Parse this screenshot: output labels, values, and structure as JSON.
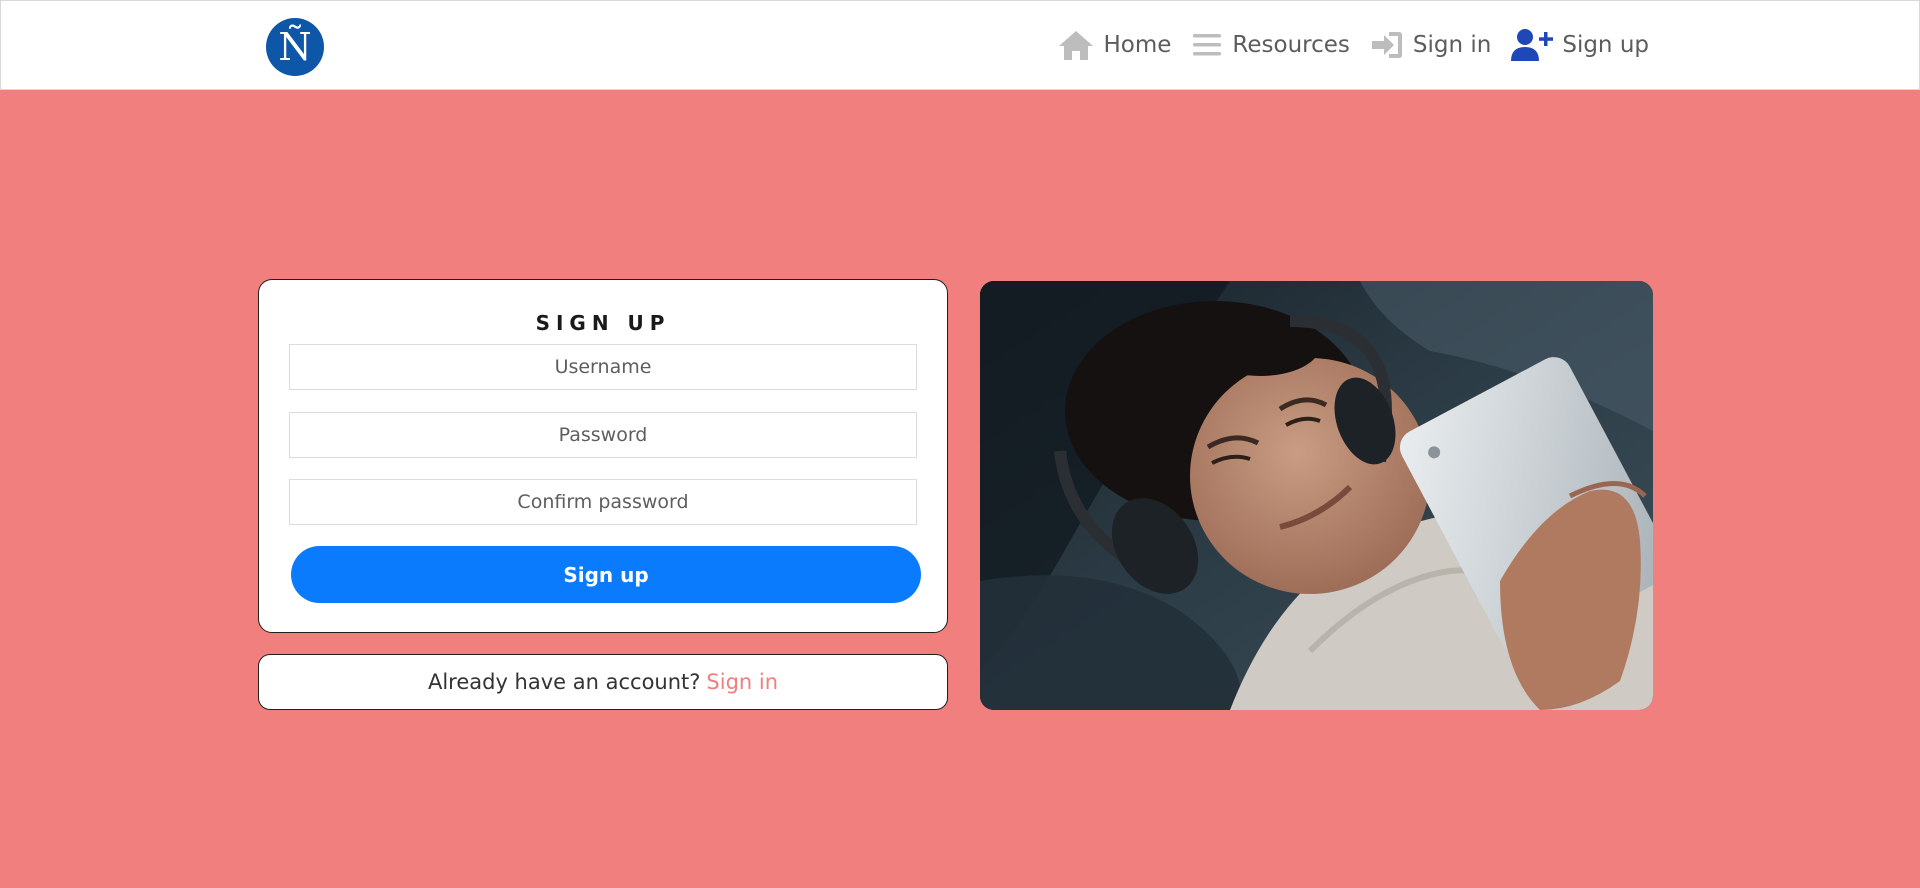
{
  "logo": {
    "glyph": "Ñ"
  },
  "nav": {
    "items": [
      {
        "label": "Home",
        "icon": "home-icon"
      },
      {
        "label": "Resources",
        "icon": "menu-icon"
      },
      {
        "label": "Sign in",
        "icon": "sign-in-icon"
      },
      {
        "label": "Sign up",
        "icon": "user-plus-icon"
      }
    ]
  },
  "form": {
    "title": "SIGN UP",
    "username_placeholder": "Username",
    "password_placeholder": "Password",
    "confirm_placeholder": "Confirm password",
    "submit_label": "Sign up"
  },
  "signin_prompt": {
    "text": "Already have an account?",
    "link": "Sign in"
  },
  "colors": {
    "page_background": "#f07f7d",
    "primary_button": "#0a7bfc",
    "logo": "#0d56a8",
    "link": "#ef7f7c",
    "signup_icon": "#1e47b8"
  }
}
